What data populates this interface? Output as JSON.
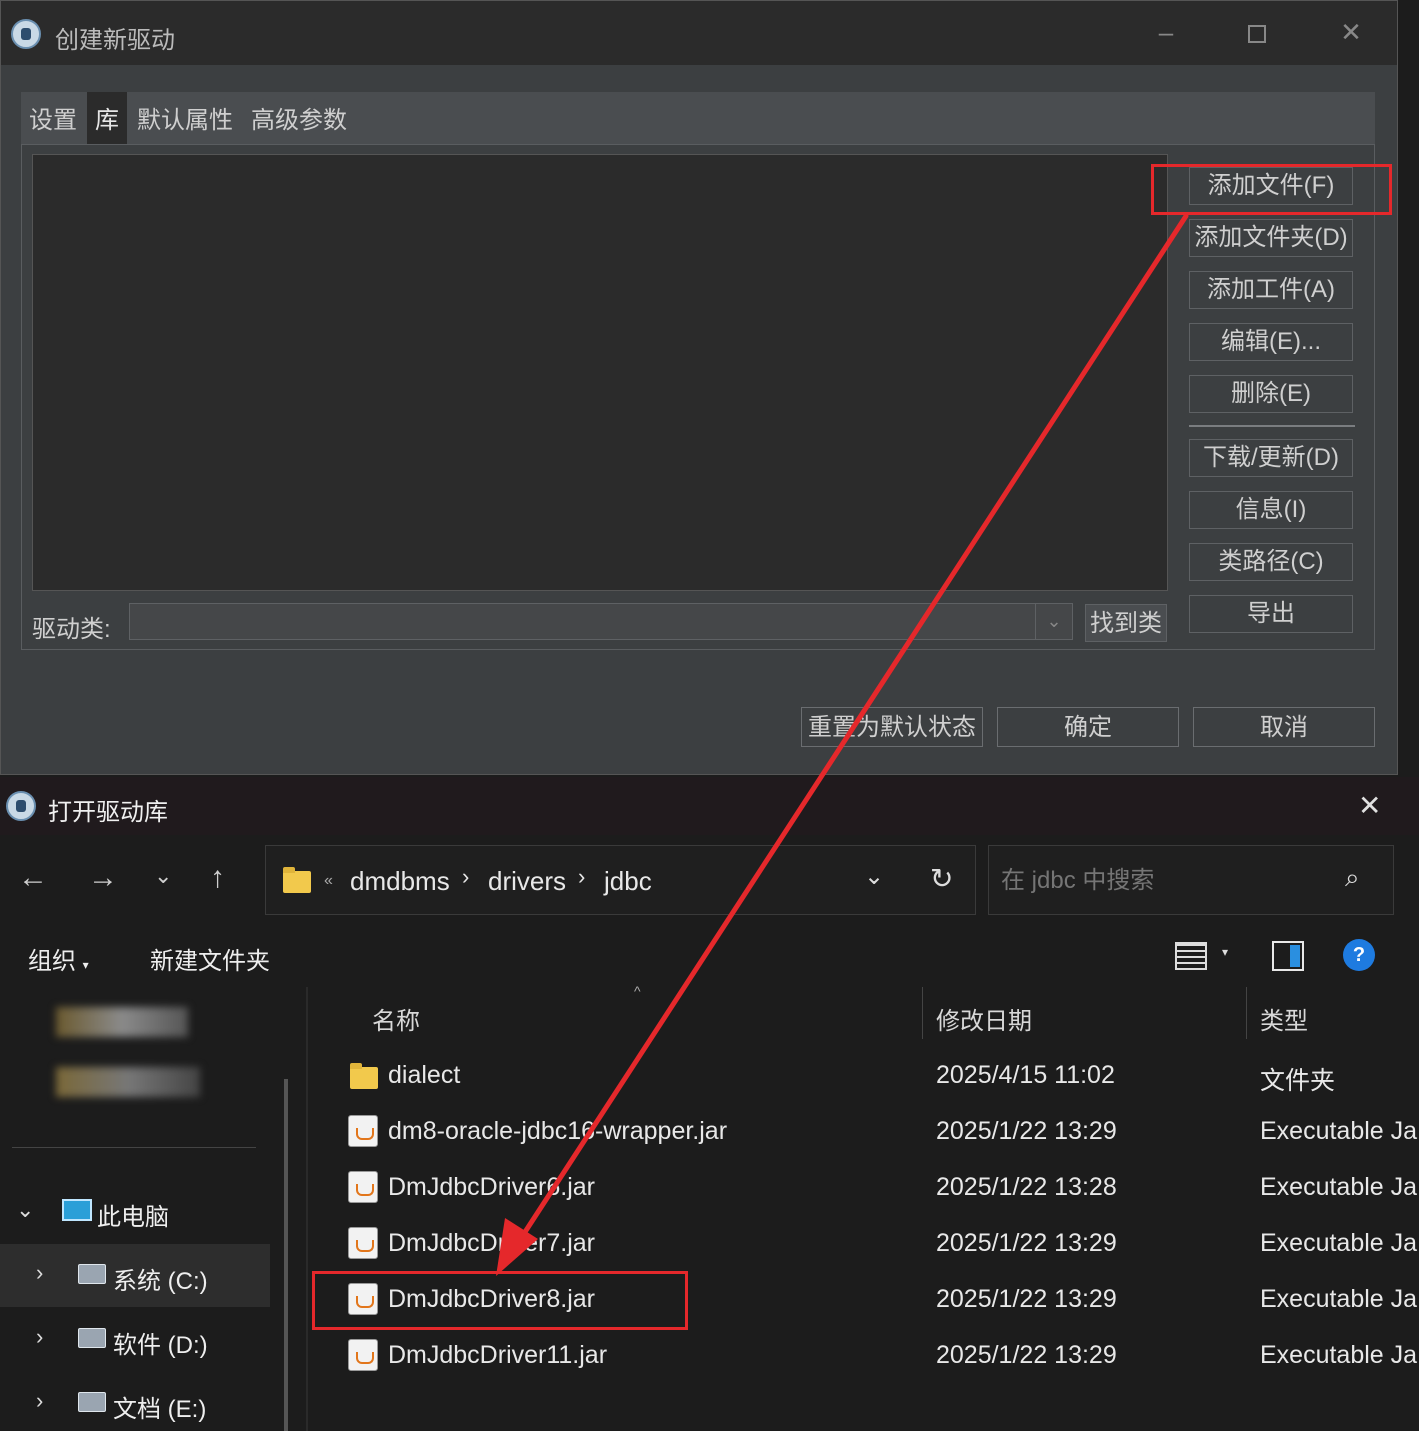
{
  "driver_dialog": {
    "title": "创建新驱动",
    "tabs": [
      "设置",
      "库",
      "默认属性",
      "高级参数"
    ],
    "active_tab": "库",
    "side_buttons": [
      "添加文件(F)",
      "添加文件夹(D)",
      "添加工件(A)",
      "编辑(E)...",
      "删除(E)",
      "下载/更新(D)",
      "信息(I)",
      "类路径(C)",
      "导出"
    ],
    "driver_class_label": "驱动类:",
    "driver_class_value": "",
    "find_class_button": "找到类",
    "footer_buttons": [
      "重置为默认状态",
      "确定",
      "取消"
    ]
  },
  "file_dialog": {
    "title": "打开驱动库",
    "breadcrumb": [
      "dmdbms",
      "drivers",
      "jdbc"
    ],
    "breadcrumb_overflow": "«",
    "search_placeholder": "在 jdbc 中搜索",
    "command_bar": {
      "organize": "组织",
      "new_folder": "新建文件夹"
    },
    "nav_pane": {
      "this_pc": "此电脑",
      "drives": [
        "系统 (C:)",
        "软件 (D:)",
        "文档 (E:)"
      ]
    },
    "columns": [
      "名称",
      "修改日期",
      "类型"
    ],
    "files": [
      {
        "name": "dialect",
        "date": "2025/4/15 11:02",
        "type": "文件夹",
        "icon": "folder-icon"
      },
      {
        "name": "dm8-oracle-jdbc16-wrapper.jar",
        "date": "2025/1/22 13:29",
        "type": "Executable Ja",
        "icon": "jar-icon"
      },
      {
        "name": "DmJdbcDriver6.jar",
        "date": "2025/1/22 13:28",
        "type": "Executable Ja",
        "icon": "jar-icon"
      },
      {
        "name": "DmJdbcDriver7.jar",
        "date": "2025/1/22 13:29",
        "type": "Executable Ja",
        "icon": "jar-icon"
      },
      {
        "name": "DmJdbcDriver8.jar",
        "date": "2025/1/22 13:29",
        "type": "Executable Ja",
        "icon": "jar-icon"
      },
      {
        "name": "DmJdbcDriver11.jar",
        "date": "2025/1/22 13:29",
        "type": "Executable Ja",
        "icon": "jar-icon"
      }
    ]
  },
  "annotation": {
    "color": "#e5282b",
    "highlighted_button": "添加文件(F)",
    "highlighted_file": "DmJdbcDriver8.jar"
  }
}
